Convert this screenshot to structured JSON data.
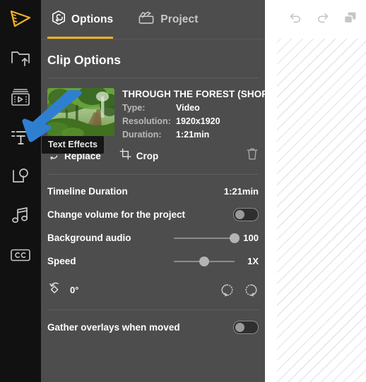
{
  "rail": {
    "items": [
      {
        "name": "app-logo",
        "icon": "film-wedge-logo"
      },
      {
        "name": "import-media",
        "icon": "folder-upload-icon"
      },
      {
        "name": "media-library",
        "icon": "film-strip-icon"
      },
      {
        "name": "text-effects",
        "icon": "text-effects-icon"
      },
      {
        "name": "shapes-overlays",
        "icon": "shapes-icon"
      },
      {
        "name": "audio",
        "icon": "music-note-icon"
      },
      {
        "name": "captions",
        "icon": "cc-icon"
      }
    ]
  },
  "tabs": {
    "options_label": "Options",
    "project_label": "Project",
    "options_icon": "wrench-hexagon-icon",
    "project_icon": "clapperboard-icon",
    "active": "Options",
    "accent": "#f0b323"
  },
  "panel": {
    "title": "Clip Options"
  },
  "clip": {
    "name": "THROUGH THE FOREST (SHOR…",
    "fields": [
      {
        "key": "Type:",
        "value": "Video"
      },
      {
        "key": "Resolution:",
        "value": "1920x1920"
      },
      {
        "key": "Duration:",
        "value": "1:21min"
      }
    ]
  },
  "actions": {
    "replace_label": "Replace",
    "replace_icon": "replace-swap-icon",
    "crop_label": "Crop",
    "crop_icon": "crop-icon",
    "delete_icon": "trash-icon"
  },
  "settings": {
    "timeline_duration_label": "Timeline Duration",
    "timeline_duration_value": "1:21min",
    "change_volume_label": "Change volume for the project",
    "change_volume_on": false,
    "background_audio_label": "Background audio",
    "background_audio_value": "100",
    "background_audio_percent": 100,
    "speed_label": "Speed",
    "speed_value": "1X",
    "speed_percent": 50,
    "rotation_value": "0°",
    "rotation_icon": "rotate-shape-icon",
    "rotate_ccw_icon": "rotate-counterclockwise-icon",
    "rotate_cw_icon": "rotate-clockwise-icon",
    "gather_overlays_label": "Gather overlays when moved",
    "gather_overlays_on": false
  },
  "tooltip": {
    "text": "Text Effects"
  },
  "topbar": {
    "undo_icon": "undo-icon",
    "redo_icon": "redo-icon",
    "duplicate_icon": "duplicate-icon"
  },
  "annotation": {
    "arrow_color": "#2f7fd1",
    "arrow_target": "text-effects"
  }
}
